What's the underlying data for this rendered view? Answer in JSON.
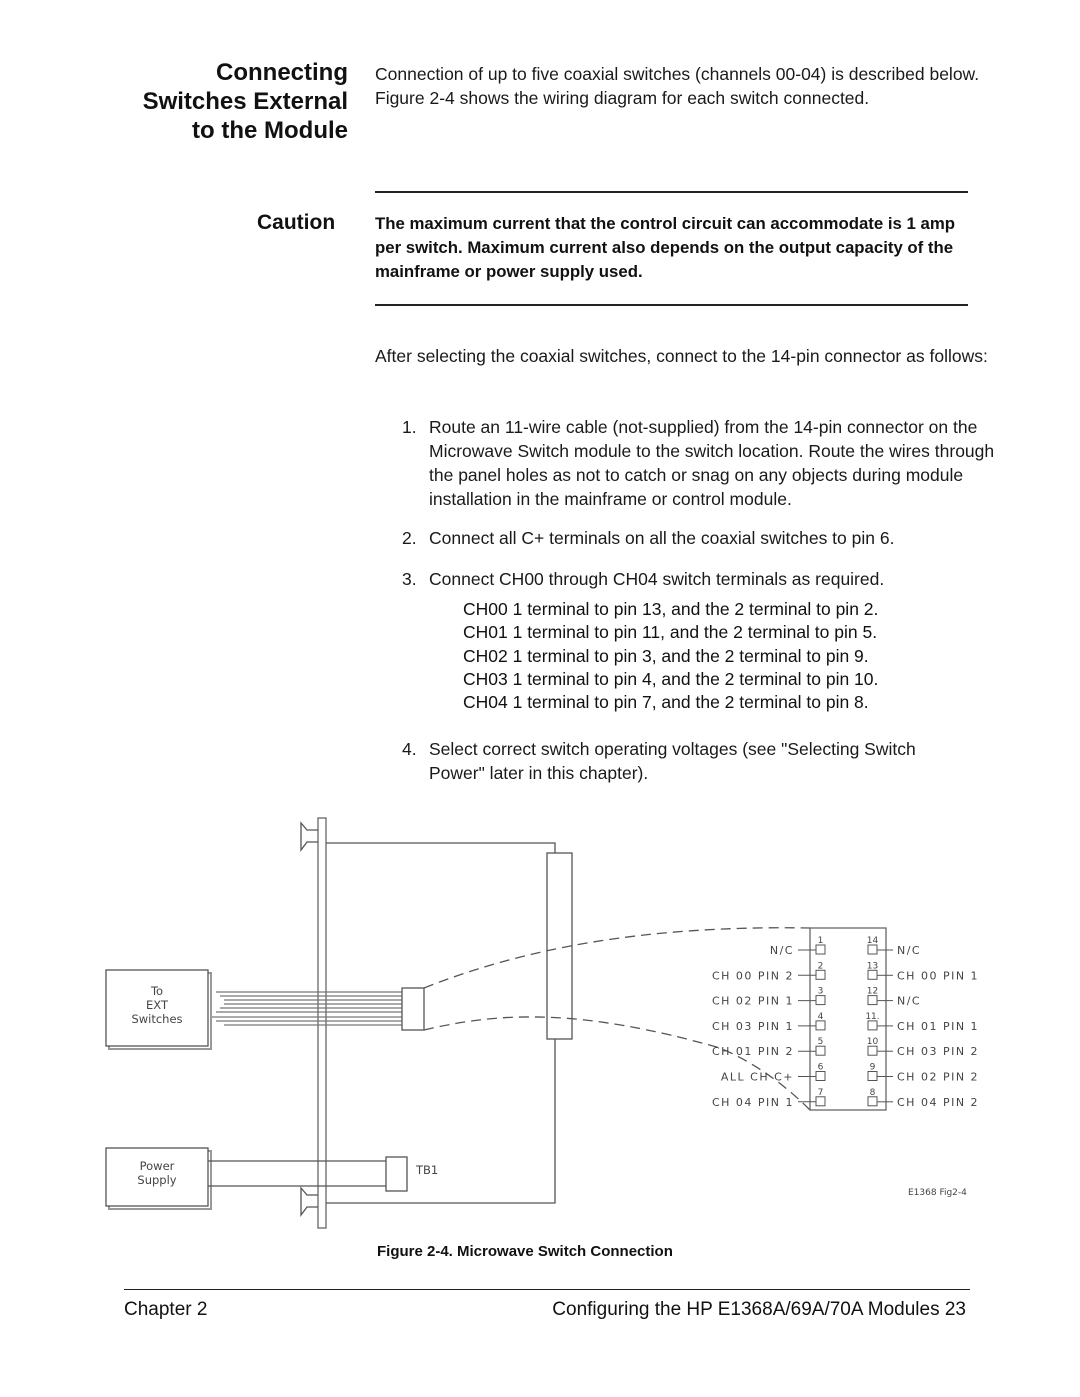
{
  "section": {
    "title_lines": [
      "Connecting",
      "Switches External",
      "to the Module"
    ],
    "intro": "Connection of up to five coaxial switches (channels 00-04) is described below.  Figure 2-4 shows the wiring diagram for each switch connected."
  },
  "caution": {
    "label": "Caution",
    "text": "The maximum current that the control circuit can accommodate is 1 amp per switch.  Maximum current also depends on the output capacity of the mainframe or power supply used."
  },
  "after_text": "After selecting the coaxial switches, connect to the 14-pin connector as follows:",
  "steps": [
    {
      "num": "1.",
      "text": "Route an 11-wire cable (not-supplied) from the 14-pin connector on the Microwave Switch module to the switch location.  Route the wires through the panel holes as not to catch or snag on any objects during module installation in the mainframe or control module."
    },
    {
      "num": "2.",
      "text": "Connect all C+ terminals on all the coaxial switches to pin 6."
    },
    {
      "num": "3.",
      "text": "Connect CH00 through CH04 switch terminals as required."
    },
    {
      "num": "4.",
      "text": "Select correct switch operating voltages (see \"Selecting Switch Power\" later in this chapter)."
    }
  ],
  "channel_map": [
    "CH00 1 terminal to pin 13, and the 2 terminal to pin 2.",
    "CH01 1 terminal to pin 11, and the 2 terminal to pin 5.",
    "CH02 1 terminal to pin 3, and the 2 terminal to pin 9.",
    "CH03 1 terminal to pin 4, and the 2 terminal to pin 10.",
    "CH04 1 terminal to pin 7, and the 2 terminal to pin 8."
  ],
  "diagram": {
    "ext_box": [
      "To",
      "EXT",
      "Switches"
    ],
    "power_box": [
      "Power",
      "Supply"
    ],
    "tb_label": "TB1",
    "fig_id": "E1368 Fig2-4",
    "left_pins": [
      {
        "num": "1",
        "label": "N/C"
      },
      {
        "num": "2",
        "label": "CH 00 PIN 2"
      },
      {
        "num": "3",
        "label": "CH 02 PIN 1"
      },
      {
        "num": "4",
        "label": "CH 03 PIN 1"
      },
      {
        "num": "5",
        "label": "CH 01 PIN 2"
      },
      {
        "num": "6",
        "label": "ALL CH C+"
      },
      {
        "num": "7",
        "label": "CH 04 PIN 1"
      }
    ],
    "right_pins": [
      {
        "num": "14",
        "label": "N/C"
      },
      {
        "num": "13",
        "label": "CH 00 PIN 1"
      },
      {
        "num": "12",
        "label": "N/C"
      },
      {
        "num": "11.",
        "label": "CH 01 PIN 1"
      },
      {
        "num": "10",
        "label": "CH 03 PIN 2"
      },
      {
        "num": "9",
        "label": "CH 02 PIN 2"
      },
      {
        "num": "8",
        "label": "CH 04 PIN 2"
      }
    ]
  },
  "figure_caption": "Figure 2-4.  Microwave Switch Connection",
  "footer": {
    "left": "Chapter 2",
    "right": "Configuring the HP E1368A/69A/70A Modules   23"
  }
}
